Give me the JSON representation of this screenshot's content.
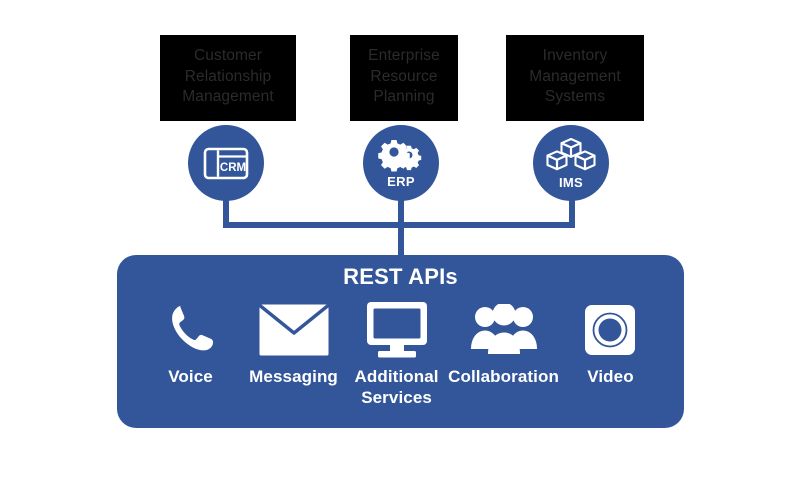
{
  "diagram": {
    "title_text": "REST APIs",
    "colors": {
      "brand_blue": "#33569A",
      "box_black": "#000000",
      "box_text_gray": "#2B2B2B",
      "white": "#FFFFFF"
    },
    "systems": [
      {
        "id": "crm",
        "box_label": "Customer\nRelationship\nManagement",
        "badge_label": "CRM",
        "icon": "browser-window-icon"
      },
      {
        "id": "erp",
        "box_label": "Enterprise\nResource\nPlanning",
        "badge_label": "ERP",
        "icon": "gears-icon"
      },
      {
        "id": "ims",
        "box_label": "Inventory\nManagement\nSystems",
        "badge_label": "IMS",
        "icon": "boxes-icon"
      }
    ],
    "services": [
      {
        "id": "voice",
        "label": "Voice",
        "icon": "phone-icon"
      },
      {
        "id": "messaging",
        "label": "Messaging",
        "icon": "envelope-icon"
      },
      {
        "id": "additional",
        "label": "Additional\nServices",
        "icon": "monitor-icon"
      },
      {
        "id": "collaboration",
        "label": "Collaboration",
        "icon": "people-group-icon"
      },
      {
        "id": "video",
        "label": "Video",
        "icon": "video-camera-icon"
      }
    ]
  }
}
